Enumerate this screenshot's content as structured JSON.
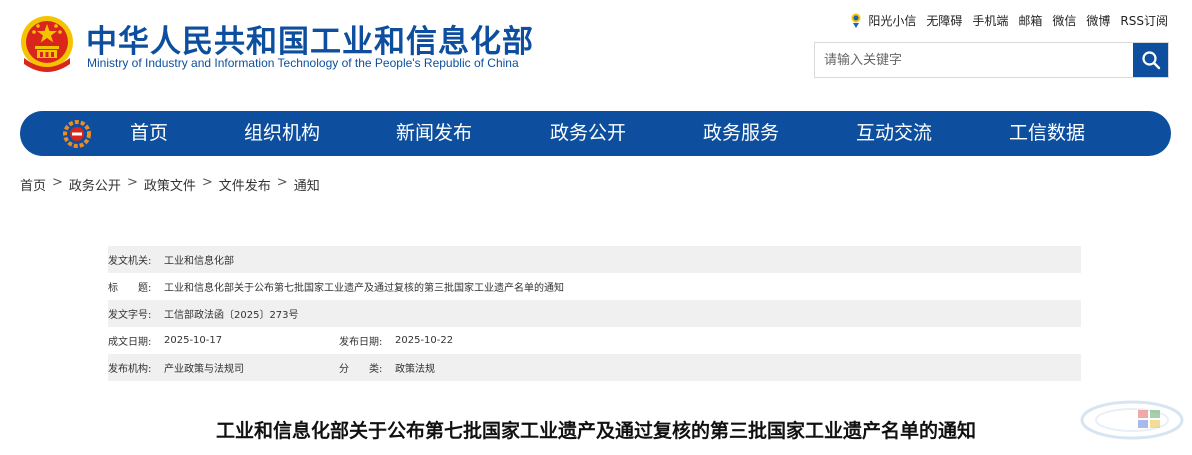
{
  "header": {
    "title_cn": "中华人民共和国工业和信息化部",
    "title_en": "Ministry of Industry and Information Technology of the People's Republic of China"
  },
  "top_links": {
    "sunshine": "阳光小信",
    "accessibility": "无障碍",
    "mobile": "手机端",
    "mail": "邮箱",
    "wechat": "微信",
    "weibo": "微博",
    "rss": "RSS订阅"
  },
  "search": {
    "placeholder": "请输入关键字"
  },
  "nav": {
    "items": [
      "首页",
      "组织机构",
      "新闻发布",
      "政务公开",
      "政务服务",
      "互动交流",
      "工信数据"
    ]
  },
  "breadcrumb": {
    "items": [
      "首页",
      "政务公开",
      "政策文件",
      "文件发布",
      "通知"
    ],
    "separator": ">"
  },
  "meta": {
    "issuer_label": "发文机关:",
    "issuer": "工业和信息化部",
    "title_label": "标　　题:",
    "title": "工业和信息化部关于公布第七批国家工业遗产及通过复核的第三批国家工业遗产名单的通知",
    "doc_no_label": "发文字号:",
    "doc_no": "工信部政法函〔2025〕273号",
    "created_label": "成文日期:",
    "created": "2025-10-17",
    "published_label": "发布日期:",
    "published": "2025-10-22",
    "org_label": "发布机构:",
    "org": "产业政策与法规司",
    "category_label": "分　　类:",
    "category": "政策法规"
  },
  "article": {
    "title": "工业和信息化部关于公布第七批国家工业遗产及通过复核的第三批国家工业遗产名单的通知"
  },
  "colors": {
    "brand_blue": "#0d4f9e",
    "row_shade": "#f0f0f0",
    "emblem_red": "#d9251c",
    "emblem_gold": "#f5c400"
  }
}
